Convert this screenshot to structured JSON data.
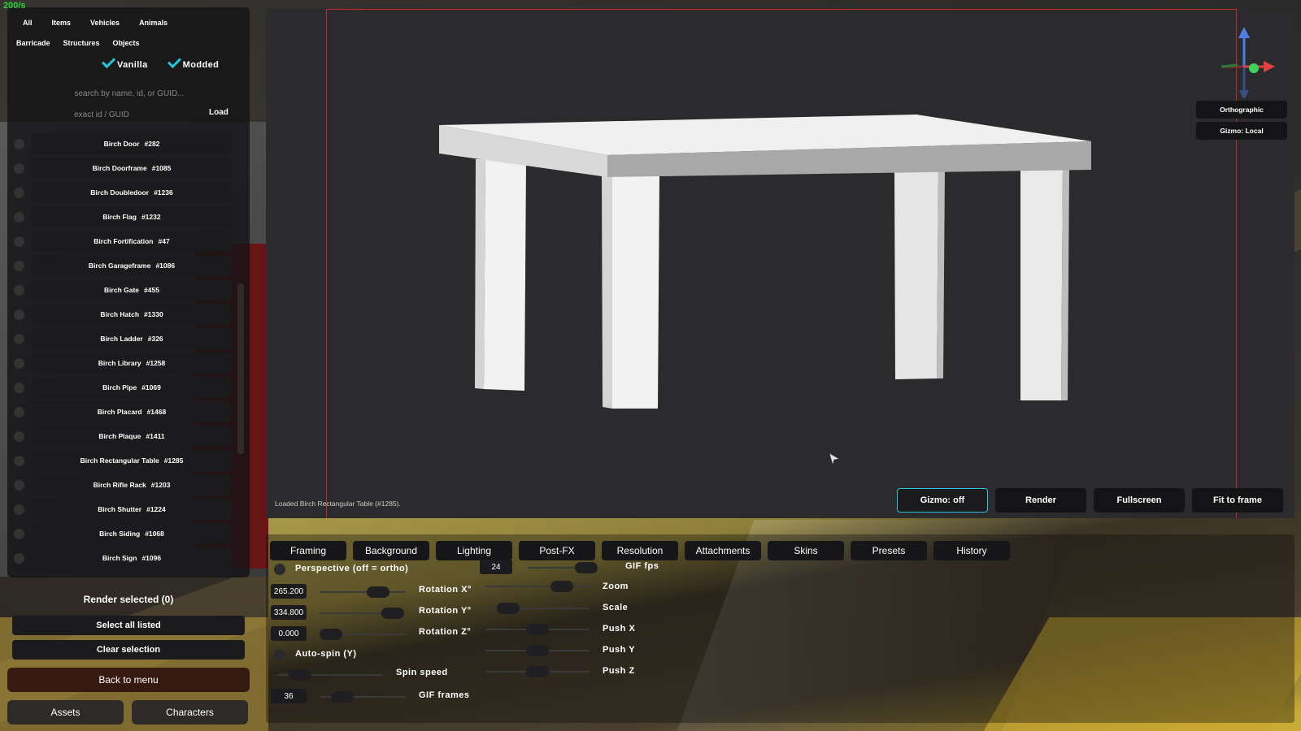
{
  "fps": "200/s",
  "categories_row1": [
    "All",
    "Items",
    "Vehicles",
    "Animals"
  ],
  "categories_row2": [
    "Barricade",
    "Structures",
    "Objects"
  ],
  "filters": {
    "vanilla": "Vanilla",
    "modded": "Modded"
  },
  "search": {
    "placeholder": "search by name, id, or GUID...",
    "id_placeholder": "exact id / GUID",
    "load_label": "Load"
  },
  "assets": [
    {
      "name": "Birch Door",
      "id": "#282"
    },
    {
      "name": "Birch Doorframe",
      "id": "#1085"
    },
    {
      "name": "Birch Doubledoor",
      "id": "#1236"
    },
    {
      "name": "Birch Flag",
      "id": "#1232"
    },
    {
      "name": "Birch Fortification",
      "id": "#47"
    },
    {
      "name": "Birch Garageframe",
      "id": "#1086"
    },
    {
      "name": "Birch Gate",
      "id": "#455"
    },
    {
      "name": "Birch Hatch",
      "id": "#1330"
    },
    {
      "name": "Birch Ladder",
      "id": "#326"
    },
    {
      "name": "Birch Library",
      "id": "#1258"
    },
    {
      "name": "Birch Pipe",
      "id": "#1069"
    },
    {
      "name": "Birch Placard",
      "id": "#1468"
    },
    {
      "name": "Birch Plaque",
      "id": "#1411"
    },
    {
      "name": "Birch Rectangular Table",
      "id": "#1285"
    },
    {
      "name": "Birch Rifle Rack",
      "id": "#1203"
    },
    {
      "name": "Birch Shutter",
      "id": "#1224"
    },
    {
      "name": "Birch Siding",
      "id": "#1068"
    },
    {
      "name": "Birch Sign",
      "id": "#1096"
    }
  ],
  "actions": {
    "render_selected": "Render selected (0)",
    "select_all": "Select all listed",
    "clear_selection": "Clear selection",
    "back_to_menu": "Back to menu",
    "assets_tab": "Assets",
    "characters_tab": "Characters"
  },
  "viewport": {
    "status": "Loaded Birch Rectangular Table (#1285).",
    "orthographic": "Orthographic",
    "gizmo_local": "Gizmo: Local",
    "gizmo_off": "Gizmo: off",
    "render": "Render",
    "fullscreen": "Fullscreen",
    "fit_to_frame": "Fit to frame"
  },
  "tabs": [
    "Framing",
    "Background",
    "Lighting",
    "Post-FX",
    "Resolution",
    "Attachments",
    "Skins",
    "Presets",
    "History"
  ],
  "controls": {
    "perspective_label": "Perspective (off = ortho)",
    "rotation_x_value": "265.200",
    "rotation_x_label": "Rotation X°",
    "rotation_y_value": "334.800",
    "rotation_y_label": "Rotation Y°",
    "rotation_z_value": "0.000",
    "rotation_z_label": "Rotation Z°",
    "autospin_label": "Auto-spin (Y)",
    "spin_speed_label": "Spin speed",
    "gif_frames_value": "36",
    "gif_frames_label": "GIF frames",
    "gif_fps_value": "24",
    "gif_fps_label": "GIF fps",
    "zoom_label": "Zoom",
    "scale_label": "Scale",
    "push_x_label": "Push X",
    "push_y_label": "Push Y",
    "push_z_label": "Push Z"
  }
}
